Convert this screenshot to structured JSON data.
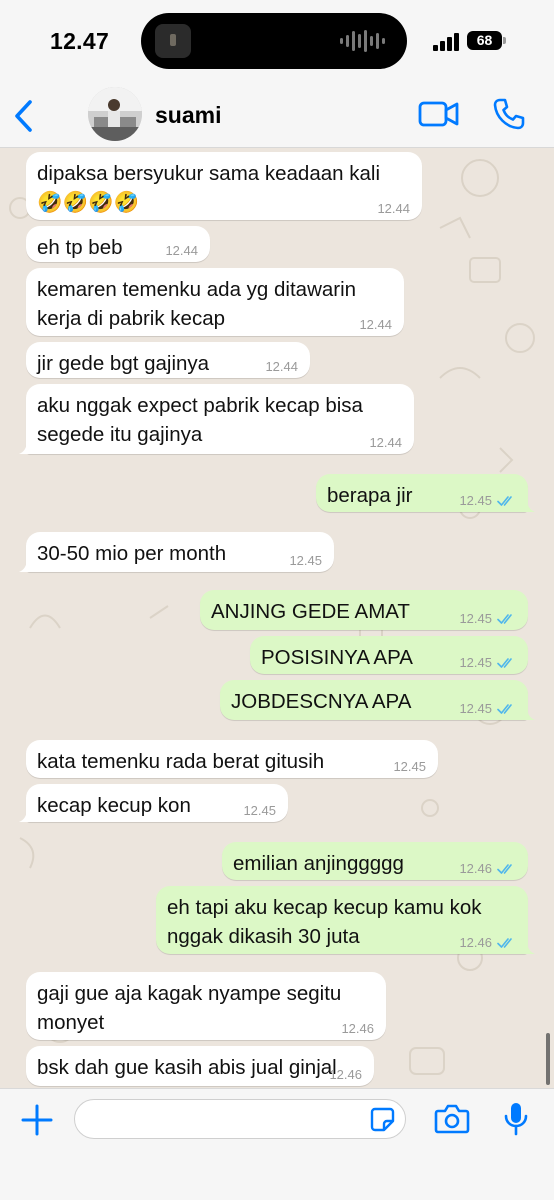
{
  "status_bar": {
    "time": "12.47",
    "battery": "68"
  },
  "header": {
    "contact_name": "suami"
  },
  "messages": [
    {
      "dir": "in",
      "lines": [
        "dipaksa bersyukur sama keadaan kali",
        "🤣🤣🤣🤣"
      ],
      "time": "12.44"
    },
    {
      "dir": "in",
      "lines": [
        "eh tp beb"
      ],
      "time": "12.44"
    },
    {
      "dir": "in",
      "lines": [
        "kemaren temenku ada yg ditawarin",
        "kerja di pabrik kecap"
      ],
      "time": "12.44"
    },
    {
      "dir": "in",
      "lines": [
        "jir gede bgt gajinya"
      ],
      "time": "12.44"
    },
    {
      "dir": "in",
      "lines": [
        "aku nggak expect pabrik kecap bisa",
        "segede itu gajinya"
      ],
      "time": "12.44"
    },
    {
      "dir": "out",
      "lines": [
        "berapa jir"
      ],
      "time": "12.45"
    },
    {
      "dir": "in",
      "lines": [
        "30-50 mio per month"
      ],
      "time": "12.45"
    },
    {
      "dir": "out",
      "lines": [
        "ANJING GEDE AMAT"
      ],
      "time": "12.45"
    },
    {
      "dir": "out",
      "lines": [
        "POSISINYA APA"
      ],
      "time": "12.45"
    },
    {
      "dir": "out",
      "lines": [
        "JOBDESCNYA APA"
      ],
      "time": "12.45"
    },
    {
      "dir": "in",
      "lines": [
        "kata temenku rada berat gitusih"
      ],
      "time": "12.45"
    },
    {
      "dir": "in",
      "lines": [
        "kecap kecup kon"
      ],
      "time": "12.45"
    },
    {
      "dir": "out",
      "lines": [
        "emilian anjinggggg"
      ],
      "time": "12.46"
    },
    {
      "dir": "out",
      "lines": [
        "eh tapi aku kecap kecup kamu kok",
        "nggak dikasih 30 juta"
      ],
      "time": "12.46"
    },
    {
      "dir": "in",
      "lines": [
        "gaji gue aja kagak nyampe segitu",
        "monyet"
      ],
      "time": "12.46"
    },
    {
      "dir": "in",
      "lines": [
        "bsk dah gue kasih abis jual ginjal"
      ],
      "time": "12.46"
    }
  ],
  "colors": {
    "accent": "#007aff",
    "incoming": "#ffffff",
    "outgoing": "#dcf8c6",
    "read_ticks": "#4fb6ec"
  },
  "icons": [
    "back-chevron-icon",
    "video-camera-icon",
    "phone-icon",
    "plus-icon",
    "sticker-icon",
    "camera-icon",
    "microphone-icon"
  ]
}
